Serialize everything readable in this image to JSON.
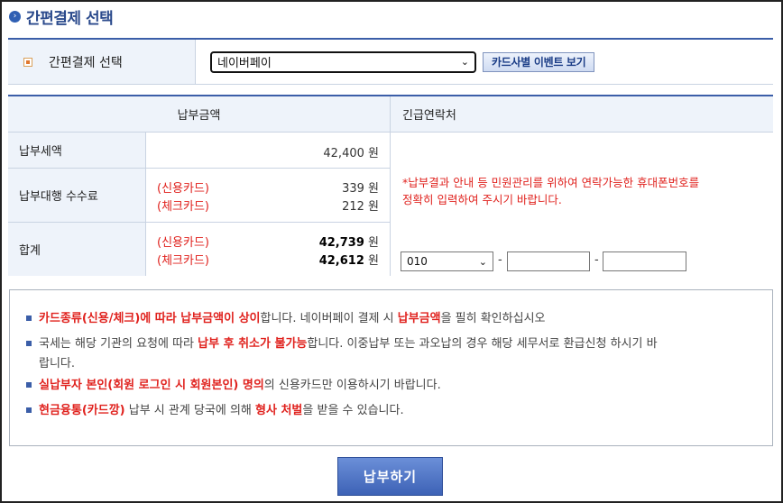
{
  "header": {
    "title": "간편결제 선택",
    "icon": "circle-chevron-right-icon"
  },
  "selection": {
    "label": "간편결제 선택",
    "dropdown_value": "네이버페이",
    "event_button": "카드사별 이벤트 보기"
  },
  "table": {
    "amount_header": "납부금액",
    "contact_header": "긴급연락처",
    "tax_label": "납부세액",
    "tax_value": "42,400",
    "fee_label": "납부대행 수수료",
    "fee_credit_kind": "(신용카드)",
    "fee_credit_value": "339",
    "fee_check_kind": "(체크카드)",
    "fee_check_value": "212",
    "total_label": "합계",
    "total_credit_kind": "(신용카드)",
    "total_credit_value": "42,739",
    "total_check_kind": "(체크카드)",
    "total_check_value": "42,612",
    "unit": "원"
  },
  "contact": {
    "notice_line1": "*납부결과 안내 등 민원관리를 위하여 연락가능한 휴대폰번호를",
    "notice_line2": "정확히 입력하여 주시기 바랍니다.",
    "phone_prefix": "010",
    "separator": "-"
  },
  "info": {
    "item1_hl1": "카드종류(신용/체크)에 따라 납부금액이 상이",
    "item1_t1": "합니다. 네이버페이 결제 시 ",
    "item1_hl2": "납부금액",
    "item1_t2": "을 필히 확인하십시오",
    "item2_t1": "국세는 해당 기관의 요청에 따라 ",
    "item2_hl1": "납부 후 취소가 불가능",
    "item2_t2": "합니다. 이중납부 또는 과오납의 경우 해당 세무서로 환급신청 하시기 바",
    "item2_t3": "랍니다.",
    "item3_hl1": "실납부자 본인(회원 로그인 시 회원본인) 명의",
    "item3_t1": "의 신용카드만 이용하시기 바랍니다.",
    "item4_hl1": "현금융통(카드깡)",
    "item4_t1": " 납부 시 관계 당국에 의해 ",
    "item4_hl2": "형사 처벌",
    "item4_t2": "을 받을 수 있습니다."
  },
  "pay_button": "납부하기",
  "colors": {
    "accent": "#3b5ea8",
    "warning": "#e0221e",
    "header_bg": "#eef3fa"
  }
}
